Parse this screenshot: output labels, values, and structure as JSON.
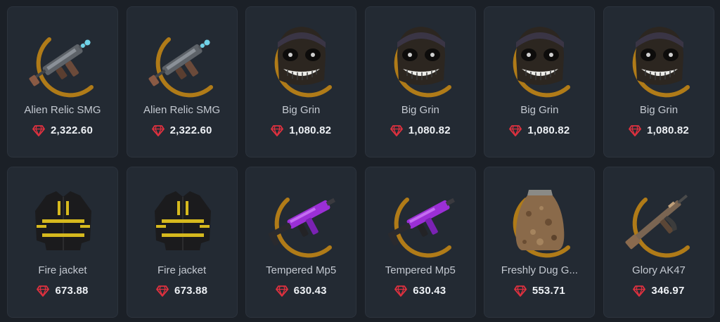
{
  "colors": {
    "background": "#1b2027",
    "card": "#232a33",
    "gem": "#e0313f",
    "ring": "#c98a14"
  },
  "currency_icon": "gem-icon",
  "items": [
    {
      "name": "Alien Relic SMG",
      "price": "2,322.60",
      "icon": "smg-icon"
    },
    {
      "name": "Alien Relic SMG",
      "price": "2,322.60",
      "icon": "smg-icon"
    },
    {
      "name": "Big Grin",
      "price": "1,080.82",
      "icon": "mask-icon"
    },
    {
      "name": "Big Grin",
      "price": "1,080.82",
      "icon": "mask-icon"
    },
    {
      "name": "Big Grin",
      "price": "1,080.82",
      "icon": "mask-icon"
    },
    {
      "name": "Big Grin",
      "price": "1,080.82",
      "icon": "mask-icon"
    },
    {
      "name": "Fire jacket",
      "price": "673.88",
      "icon": "jacket-icon"
    },
    {
      "name": "Fire jacket",
      "price": "673.88",
      "icon": "jacket-icon"
    },
    {
      "name": "Tempered Mp5",
      "price": "630.43",
      "icon": "mp5-icon"
    },
    {
      "name": "Tempered Mp5",
      "price": "630.43",
      "icon": "mp5-icon"
    },
    {
      "name": "Freshly Dug G...",
      "price": "553.71",
      "icon": "sack-icon"
    },
    {
      "name": "Glory AK47",
      "price": "346.97",
      "icon": "ak47-icon"
    }
  ]
}
